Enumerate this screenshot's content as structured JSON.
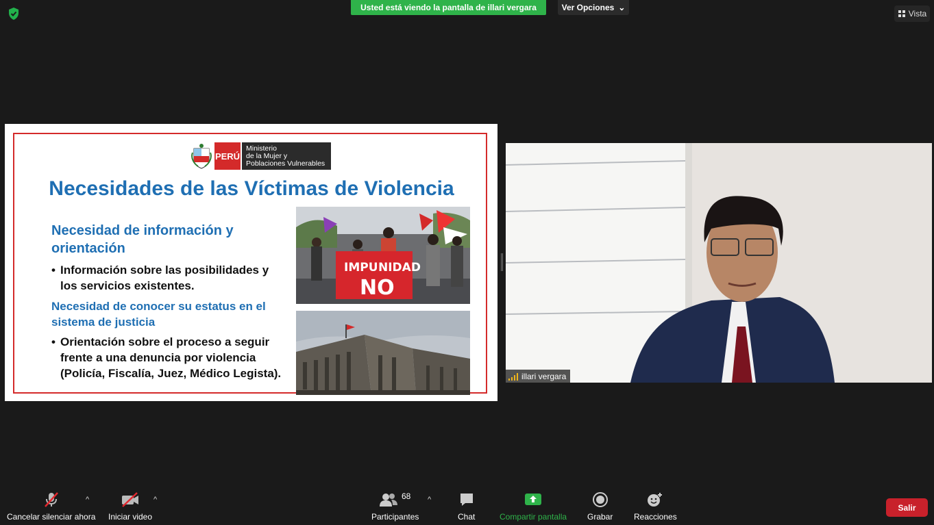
{
  "top_bar": {
    "sharing_banner": "Usted está viendo la pantalla de illari vergara",
    "view_options_label": "Ver Opciones",
    "view_label": "Vista",
    "security_icon": "shield-check-icon"
  },
  "slide": {
    "logo_country": "PERÚ",
    "logo_ministry": [
      "Ministerio",
      "de la Mujer y",
      "Poblaciones Vulnerables"
    ],
    "title": "Necesidades de las Víctimas de Violencia",
    "section1_heading": "Necesidad de información y orientación",
    "section1_bullet": "Información sobre las posibilidades y los servicios existentes.",
    "section2_heading": "Necesidad de conocer su estatus en el sistema de justicia",
    "section2_bullet": "Orientación sobre el proceso a seguir frente a una denuncia por violencia (Policía, Fiscalía, Juez, Médico Legista).",
    "bullet_char": "•",
    "photo1_sign": [
      "IMPU",
      "NIDAD",
      "NO"
    ],
    "accent_color": "#1f6fb3",
    "frame_color": "#d42a2a"
  },
  "video": {
    "participant_name": "illari vergara"
  },
  "toolbar": {
    "mute_label": "Cancelar silenciar ahora",
    "video_label": "Iniciar video",
    "participants_label": "Participantes",
    "participants_count": "68",
    "chat_label": "Chat",
    "share_label": "Compartir pantalla",
    "record_label": "Grabar",
    "reactions_label": "Reacciones",
    "leave_label": "Salir",
    "share_color": "#2fb34a",
    "leave_color": "#c8212b"
  }
}
